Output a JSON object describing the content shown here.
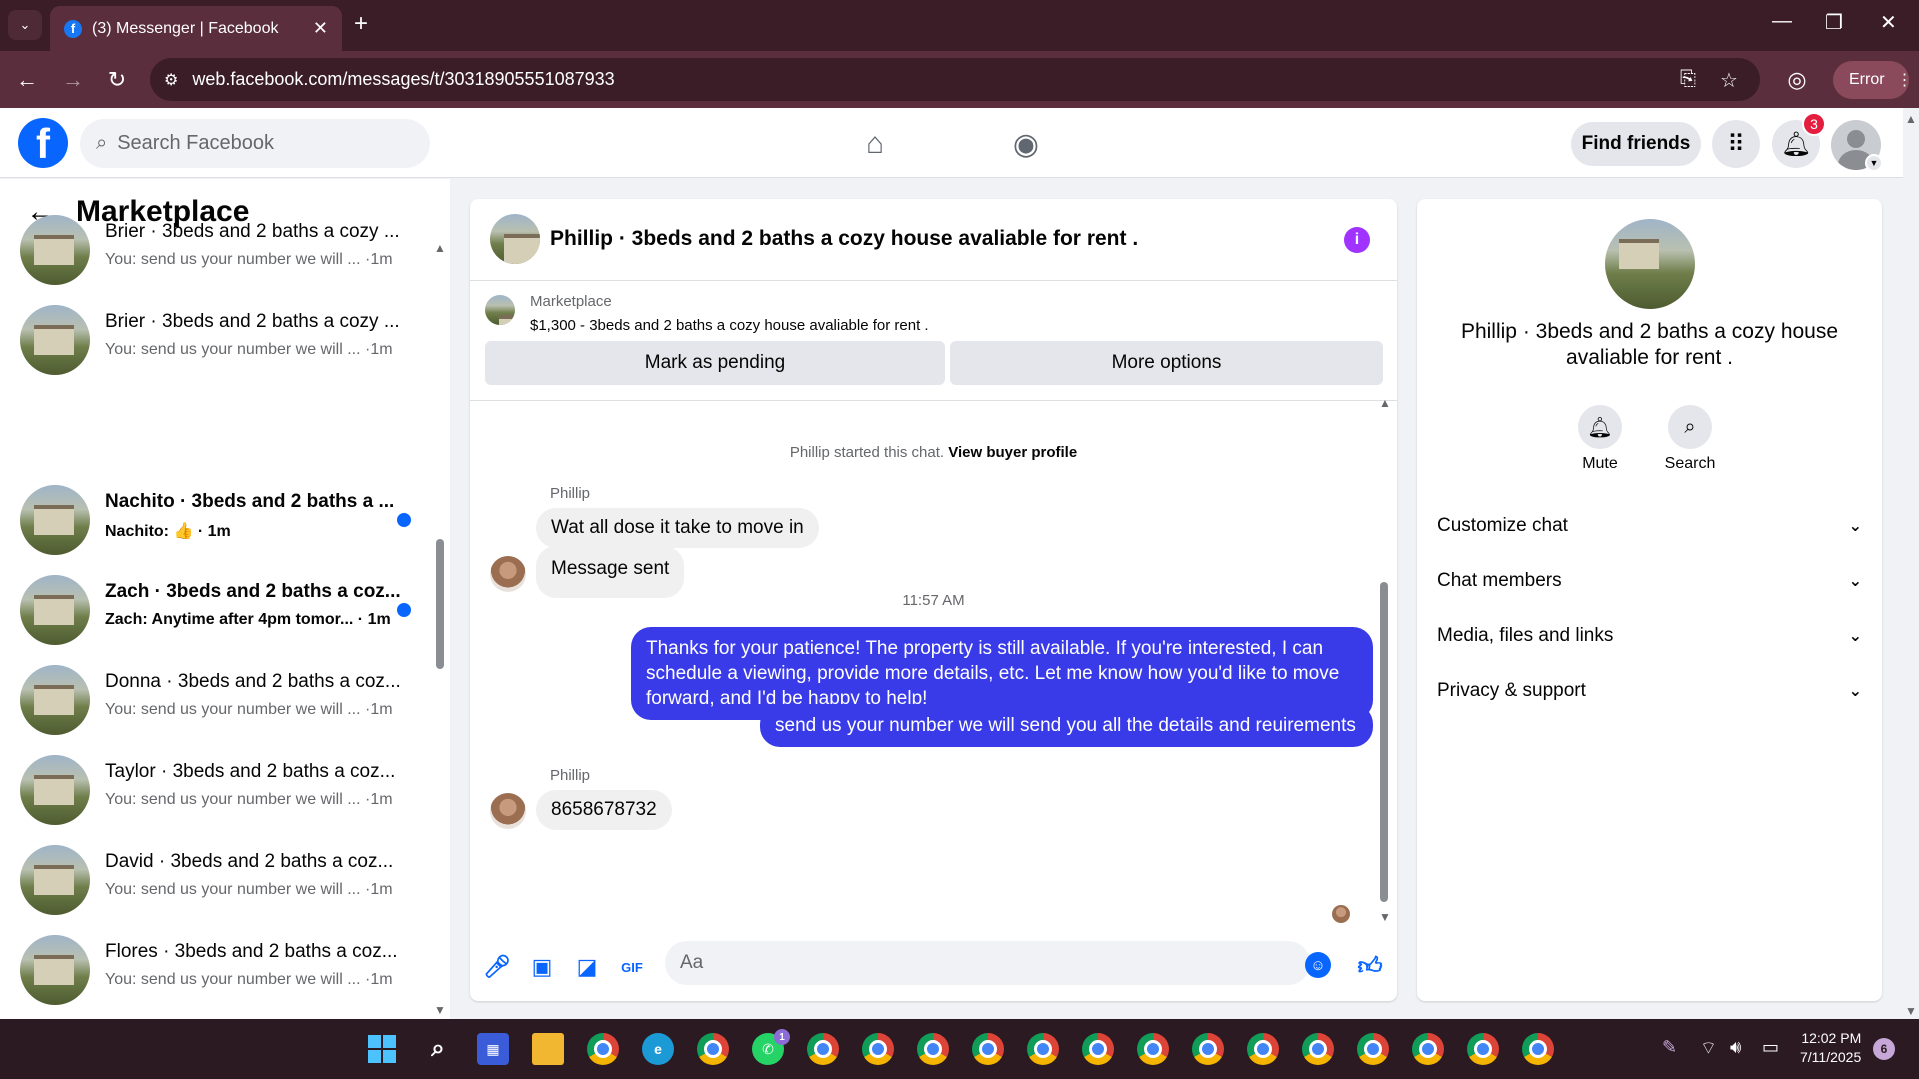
{
  "browser": {
    "tab_title": "(3) Messenger | Facebook",
    "url": "web.facebook.com/messages/t/30318905551087933",
    "profile_button": "Error"
  },
  "fb": {
    "search_placeholder": "Search Facebook",
    "find_friends": "Find friends",
    "notification_count": "3"
  },
  "sidebar": {
    "title": "Marketplace",
    "conversations": [
      {
        "name": "Brier · 3beds and 2 baths a cozy ...",
        "preview": "You: send us your number we will ... ·1m",
        "unread": false
      },
      {
        "name": "Brier · 3beds and 2 baths a cozy ...",
        "preview": "You: send us your number we will ... ·1m",
        "unread": false
      },
      {
        "name": "Nachito · 3beds and 2 baths a ...",
        "preview": "Nachito: 👍 · 1m",
        "unread": true
      },
      {
        "name": "Zach · 3beds and 2 baths a coz...",
        "preview": "Zach: Anytime after 4pm tomor... · 1m",
        "unread": true
      },
      {
        "name": "Donna · 3beds and 2 baths a coz...",
        "preview": "You: send us your number we will ... ·1m",
        "unread": false
      },
      {
        "name": "Taylor · 3beds and 2 baths a coz...",
        "preview": "You: send us your number we will ... ·1m",
        "unread": false
      },
      {
        "name": "David · 3beds and 2 baths a coz...",
        "preview": "You: send us your number we will ... ·1m",
        "unread": false
      },
      {
        "name": "Flores · 3beds and 2 baths a coz...",
        "preview": "You: send us your number we will ... ·1m",
        "unread": false
      }
    ]
  },
  "chat": {
    "title": "Phillip · 3beds and 2 baths a cozy house avaliable for rent .",
    "marketplace_label": "Marketplace",
    "listing": "$1,300 - 3beds and 2 baths a cozy house avaliable for rent .",
    "mark_pending": "Mark as pending",
    "more_options": "More options",
    "system_text": "Phillip started this chat.",
    "system_link": "View buyer profile",
    "sender_1": "Phillip",
    "msg_in_1": "Wat all dose it take to move in",
    "msg_in_2": "Message sent",
    "time_separator": "11:57 AM",
    "msg_out_1": "Thanks for your patience! The property is still available. If you're interested, I can schedule a viewing, provide more details, etc. Let me know how you'd like to move forward, and I'd be happy to help!",
    "msg_out_2": "send us your number we will send you all  the details and reuirements",
    "sender_2": "Phillip",
    "msg_in_3": "8658678732",
    "composer_placeholder": "Aa"
  },
  "info_panel": {
    "title": "Phillip · 3beds and 2 baths a cozy house avaliable for rent .",
    "actions": [
      {
        "label": "Mute",
        "icon": "bell-icon"
      },
      {
        "label": "Search",
        "icon": "search-icon"
      }
    ],
    "sections": [
      "Customize chat",
      "Chat members",
      "Media, files and links",
      "Privacy & support"
    ]
  },
  "taskbar": {
    "time": "12:02 PM",
    "date": "7/11/2025",
    "notifications": "6",
    "whatsapp_badge": "1"
  },
  "colors": {
    "fb_blue": "#0866ff",
    "outgoing_bubble": "#3a3be8",
    "chrome_frame": "#5a2e3c"
  }
}
